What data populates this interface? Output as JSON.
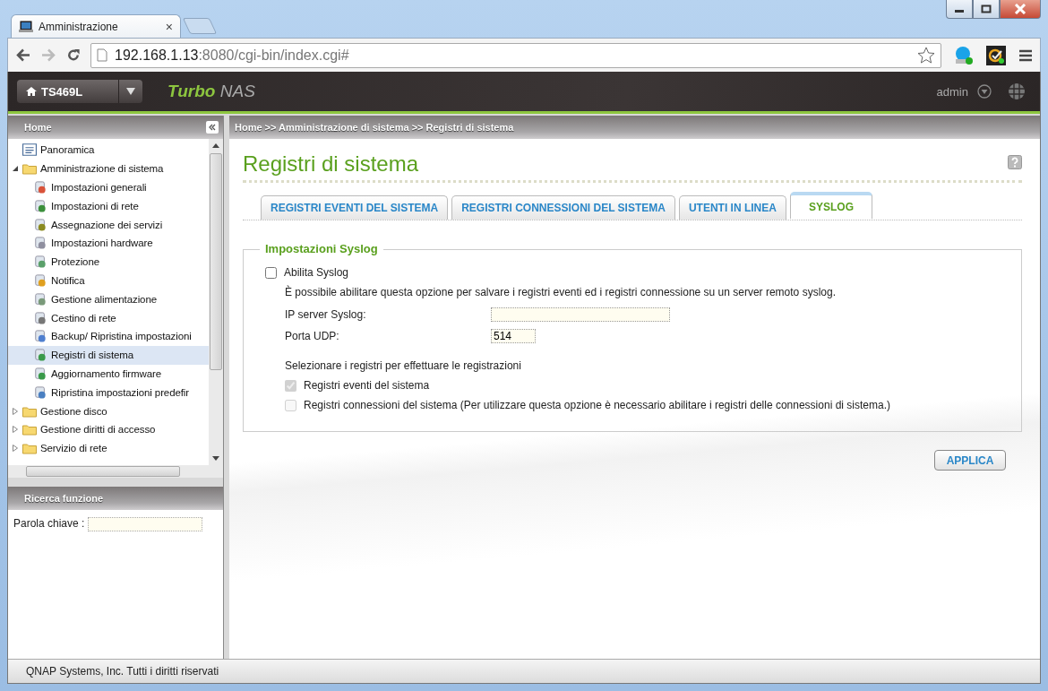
{
  "browser": {
    "tab": {
      "title": "Amministrazione",
      "close": "×"
    },
    "url": {
      "host": "192.168.1.13",
      "path": ":8080/cgi-bin/index.cgi#"
    }
  },
  "header": {
    "device": "TS469L",
    "brand_bold": "Turbo",
    "brand": "NAS",
    "user": "admin"
  },
  "sidebar": {
    "title": "Home",
    "tree": [
      {
        "label": "Panoramica",
        "kind": "page",
        "selected": false
      },
      {
        "label": "Amministrazione di sistema",
        "kind": "folder",
        "expanded": true,
        "children": [
          {
            "label": "Impostazioni generali",
            "kind": "page",
            "selected": false
          },
          {
            "label": "Impostazioni di rete",
            "kind": "page",
            "selected": false
          },
          {
            "label": "Assegnazione dei servizi",
            "kind": "page",
            "selected": false
          },
          {
            "label": "Impostazioni hardware",
            "kind": "page",
            "selected": false
          },
          {
            "label": "Protezione",
            "kind": "page",
            "selected": false
          },
          {
            "label": "Notifica",
            "kind": "page",
            "selected": false
          },
          {
            "label": "Gestione alimentazione",
            "kind": "page",
            "selected": false
          },
          {
            "label": "Cestino di rete",
            "kind": "page",
            "selected": false
          },
          {
            "label": "Backup/ Ripristina impostazioni",
            "kind": "page",
            "selected": false
          },
          {
            "label": "Registri di sistema",
            "kind": "page",
            "selected": true
          },
          {
            "label": "Aggiornamento firmware",
            "kind": "page",
            "selected": false
          },
          {
            "label": "Ripristina impostazioni predefir",
            "kind": "page",
            "selected": false
          }
        ]
      },
      {
        "label": "Gestione disco",
        "kind": "folder",
        "expanded": false
      },
      {
        "label": "Gestione diritti di accesso",
        "kind": "folder",
        "expanded": false
      },
      {
        "label": "Servizio di rete",
        "kind": "folder",
        "expanded": false
      }
    ]
  },
  "search": {
    "title": "Ricerca funzione",
    "label": "Parola chiave :"
  },
  "breadcrumb": "Home >> Amministrazione di sistema >> Registri di sistema",
  "page": {
    "title": "Registri di sistema",
    "tabs": [
      {
        "label": "REGISTRI EVENTI DEL SISTEMA",
        "selected": false
      },
      {
        "label": "REGISTRI CONNESSIONI DEL SISTEMA",
        "selected": false
      },
      {
        "label": "UTENTI IN LINEA",
        "selected": false
      },
      {
        "label": "SYSLOG",
        "selected": true
      }
    ],
    "legend": "Impostazioni Syslog",
    "enable": {
      "label": "Abilita Syslog",
      "checked": false
    },
    "description": "È possibile abilitare questa opzione per salvare i registri eventi ed i registri connessione su un server remoto syslog.",
    "fields": [
      {
        "label": "IP server Syslog:",
        "kind": "wide"
      },
      {
        "label": "Porta UDP:",
        "kind": "short",
        "value": "514"
      }
    ],
    "select_label": "Selezionare i registri per effettuare le registrazioni",
    "logs": [
      {
        "label": "Registri eventi del sistema",
        "checked": true,
        "disabled": true
      },
      {
        "label": "Registri connessioni del sistema (Per utilizzare questa opzione è necessario abilitare i registri delle connessioni di sistema.)",
        "checked": false,
        "disabled": true
      }
    ],
    "apply": "APPLICA"
  },
  "footer": "QNAP Systems, Inc. Tutti i diritti riservati"
}
